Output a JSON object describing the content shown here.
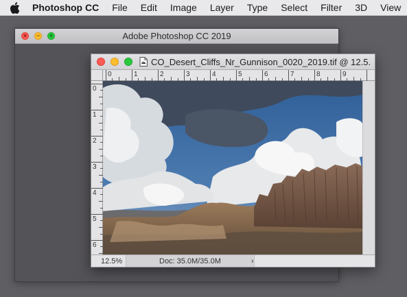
{
  "menubar": {
    "apple_icon": "apple-logo-icon",
    "app_name": "Photoshop CC",
    "items": [
      "File",
      "Edit",
      "Image",
      "Layer",
      "Type",
      "Select",
      "Filter",
      "3D",
      "View"
    ]
  },
  "app_window": {
    "title": "Adobe Photoshop CC 2019",
    "controls": {
      "close_glyph": "×",
      "minimize_glyph": "−",
      "zoom_glyph": "+"
    }
  },
  "doc_window": {
    "title": "CO_Desert_Cliffs_Nr_Gunnison_0020_2019.tif @ 12.5...",
    "file_icon": "photoshop-document-icon",
    "ruler_top": [
      "0",
      "1",
      "2",
      "3",
      "4",
      "5",
      "6",
      "7",
      "8",
      "9"
    ],
    "ruler_left": [
      "0",
      "1",
      "2",
      "3",
      "4",
      "5",
      "6"
    ],
    "status": {
      "zoom": "12.5%",
      "doc_info": "Doc: 35.0M/35.0M",
      "menu_arrow": "›"
    }
  },
  "colors": {
    "desktop": "#5f5e63",
    "close": "#fd5b53",
    "minimize": "#fdbd2e",
    "zoom": "#2ac83f"
  }
}
